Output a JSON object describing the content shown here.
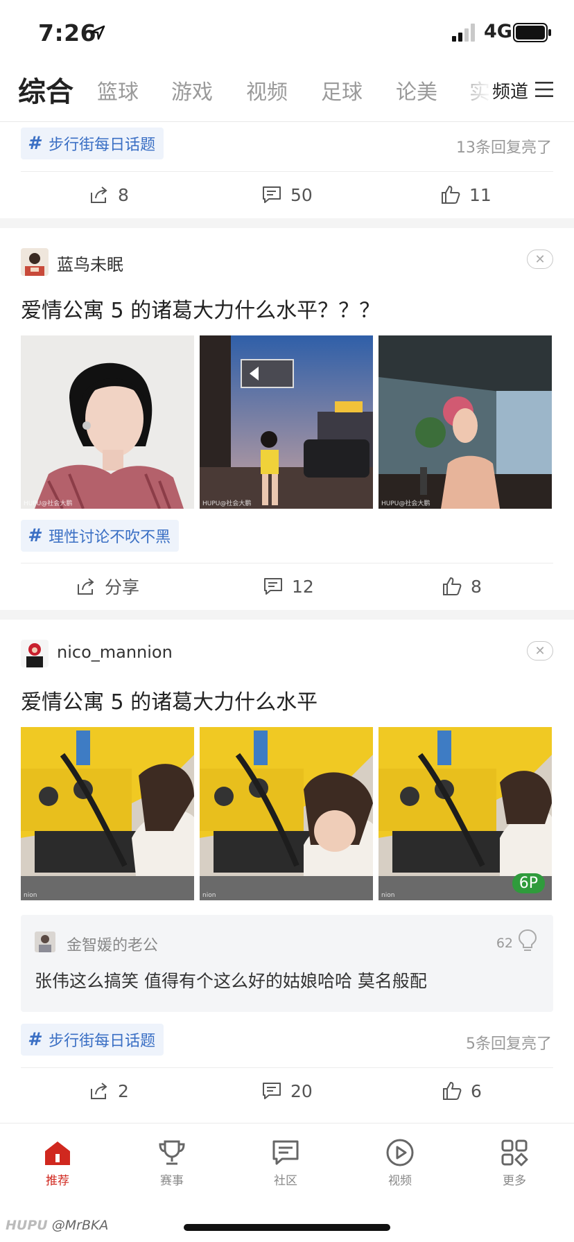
{
  "status_bar": {
    "time": "7:26",
    "network": "4G"
  },
  "top_nav": {
    "tabs": [
      "综合",
      "篮球",
      "游戏",
      "视频",
      "足球",
      "论美",
      "实"
    ],
    "active_index": 0,
    "channel_label": "频道"
  },
  "prev_post": {
    "topic": "步行街每日话题",
    "replies_lit": "13条回复亮了",
    "shares": "8",
    "comments": "50",
    "likes": "11"
  },
  "post1": {
    "username": "蓝鸟未眠",
    "title": "爱情公寓 5 的诸葛大力什么水平？？？",
    "topic": "理性讨论不吹不黑",
    "share_label": "分享",
    "comments": "12",
    "likes": "8",
    "image_watermarks": [
      "HUPU@社会大鹏",
      "HUPU@社会大鹏",
      "HUPU@社会大鹏"
    ]
  },
  "post2": {
    "username": "nico_mannion",
    "title": "爱情公寓 5 的诸葛大力什么水平",
    "image_watermarks": [
      "nion",
      "nion",
      "nion"
    ],
    "image_count_badge": "6P",
    "hot_comment": {
      "user": "金智媛的老公",
      "likes": "62",
      "text": "张伟这么搞笑 值得有个这么好的姑娘哈哈 莫名般配"
    },
    "topic": "步行街每日话题",
    "replies_lit": "5条回复亮了",
    "shares": "2",
    "comments": "20",
    "likes": "6"
  },
  "tab_bar": {
    "items": [
      {
        "label": "推荐",
        "icon": "home-icon"
      },
      {
        "label": "赛事",
        "icon": "trophy-icon"
      },
      {
        "label": "社区",
        "icon": "community-icon"
      },
      {
        "label": "视频",
        "icon": "play-icon"
      },
      {
        "label": "更多",
        "icon": "more-grid-icon"
      }
    ],
    "active_index": 0
  },
  "watermark": {
    "brand": "HUPU",
    "handle": "@MrBKA"
  },
  "colors": {
    "accent_red": "#d0281f",
    "topic_blue": "#3a6fc4",
    "badge_green": "#2f9b3c"
  }
}
